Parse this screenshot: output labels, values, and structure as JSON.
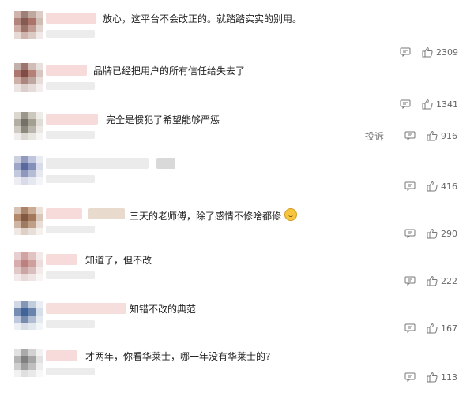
{
  "comments": [
    {
      "text": "放心，这平台不会改正的。就踏踏实实的别用。",
      "likes": "2309"
    },
    {
      "text": "品牌已经把用户的所有信任给失去了",
      "likes": "1341"
    },
    {
      "text": "完全是惯犯了希望能够严惩",
      "likes": "916",
      "report_label": "投诉"
    },
    {
      "text": "",
      "likes": "416"
    },
    {
      "text": "三天的老师傅，除了感情不修啥都修",
      "likes": "290"
    },
    {
      "text": "知道了，但不改",
      "likes": "222"
    },
    {
      "text": "知错不改的典范",
      "likes": "167"
    },
    {
      "text": "才两年，你看华莱士，哪一年没有华莱士的?",
      "likes": "113"
    }
  ],
  "icons": {
    "reply": "comment-bubble-icon",
    "like": "thumbs-up-icon"
  }
}
